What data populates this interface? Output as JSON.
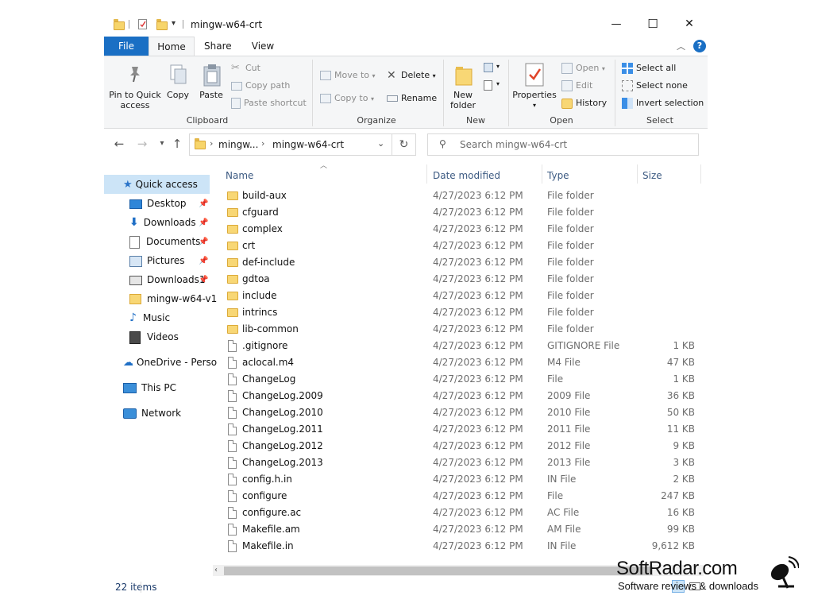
{
  "window": {
    "title": "mingw-w64-crt",
    "minimize_glyph": "—",
    "maximize_glyph": "☐",
    "close_glyph": "✕"
  },
  "tabs": [
    "File",
    "Home",
    "Share",
    "View"
  ],
  "ribbon": {
    "clipboard": {
      "label": "Clipboard",
      "pin_line1": "Pin to Quick",
      "pin_line2": "access",
      "copy": "Copy",
      "paste": "Paste",
      "cut": "Cut",
      "copy_path": "Copy path",
      "paste_shortcut": "Paste shortcut"
    },
    "organize": {
      "label": "Organize",
      "move_to": "Move to",
      "copy_to": "Copy to",
      "delete": "Delete",
      "rename": "Rename"
    },
    "new": {
      "label": "New",
      "new_folder_line1": "New",
      "new_folder_line2": "folder"
    },
    "open": {
      "label": "Open",
      "properties": "Properties",
      "open": "Open",
      "edit": "Edit",
      "history": "History"
    },
    "select": {
      "label": "Select",
      "select_all": "Select all",
      "select_none": "Select none",
      "invert_selection": "Invert selection"
    }
  },
  "address": {
    "crumb1": "mingw...",
    "crumb2": "mingw-w64-crt",
    "search_placeholder": "Search mingw-w64-crt"
  },
  "sidebar": {
    "quick_access": "Quick access",
    "items": [
      "Desktop",
      "Downloads",
      "Documents",
      "Pictures",
      "Downloads1",
      "mingw-w64-v1",
      "Music",
      "Videos"
    ],
    "onedrive": "OneDrive - Perso",
    "this_pc": "This PC",
    "network": "Network"
  },
  "columns": {
    "name": "Name",
    "date": "Date modified",
    "type": "Type",
    "size": "Size"
  },
  "files": [
    {
      "name": "build-aux",
      "date": "4/27/2023 6:12 PM",
      "type": "File folder",
      "size": "",
      "folder": true
    },
    {
      "name": "cfguard",
      "date": "4/27/2023 6:12 PM",
      "type": "File folder",
      "size": "",
      "folder": true
    },
    {
      "name": "complex",
      "date": "4/27/2023 6:12 PM",
      "type": "File folder",
      "size": "",
      "folder": true
    },
    {
      "name": "crt",
      "date": "4/27/2023 6:12 PM",
      "type": "File folder",
      "size": "",
      "folder": true
    },
    {
      "name": "def-include",
      "date": "4/27/2023 6:12 PM",
      "type": "File folder",
      "size": "",
      "folder": true
    },
    {
      "name": "gdtoa",
      "date": "4/27/2023 6:12 PM",
      "type": "File folder",
      "size": "",
      "folder": true
    },
    {
      "name": "include",
      "date": "4/27/2023 6:12 PM",
      "type": "File folder",
      "size": "",
      "folder": true
    },
    {
      "name": "intrincs",
      "date": "4/27/2023 6:12 PM",
      "type": "File folder",
      "size": "",
      "folder": true
    },
    {
      "name": "lib-common",
      "date": "4/27/2023 6:12 PM",
      "type": "File folder",
      "size": "",
      "folder": true
    },
    {
      "name": ".gitignore",
      "date": "4/27/2023 6:12 PM",
      "type": "GITIGNORE File",
      "size": "1 KB",
      "folder": false
    },
    {
      "name": "aclocal.m4",
      "date": "4/27/2023 6:12 PM",
      "type": "M4 File",
      "size": "47 KB",
      "folder": false
    },
    {
      "name": "ChangeLog",
      "date": "4/27/2023 6:12 PM",
      "type": "File",
      "size": "1 KB",
      "folder": false
    },
    {
      "name": "ChangeLog.2009",
      "date": "4/27/2023 6:12 PM",
      "type": "2009 File",
      "size": "36 KB",
      "folder": false
    },
    {
      "name": "ChangeLog.2010",
      "date": "4/27/2023 6:12 PM",
      "type": "2010 File",
      "size": "50 KB",
      "folder": false
    },
    {
      "name": "ChangeLog.2011",
      "date": "4/27/2023 6:12 PM",
      "type": "2011 File",
      "size": "11 KB",
      "folder": false
    },
    {
      "name": "ChangeLog.2012",
      "date": "4/27/2023 6:12 PM",
      "type": "2012 File",
      "size": "9 KB",
      "folder": false
    },
    {
      "name": "ChangeLog.2013",
      "date": "4/27/2023 6:12 PM",
      "type": "2013 File",
      "size": "3 KB",
      "folder": false
    },
    {
      "name": "config.h.in",
      "date": "4/27/2023 6:12 PM",
      "type": "IN File",
      "size": "2 KB",
      "folder": false
    },
    {
      "name": "configure",
      "date": "4/27/2023 6:12 PM",
      "type": "File",
      "size": "247 KB",
      "folder": false
    },
    {
      "name": "configure.ac",
      "date": "4/27/2023 6:12 PM",
      "type": "AC File",
      "size": "16 KB",
      "folder": false
    },
    {
      "name": "Makefile.am",
      "date": "4/27/2023 6:12 PM",
      "type": "AM File",
      "size": "99 KB",
      "folder": false
    },
    {
      "name": "Makefile.in",
      "date": "4/27/2023 6:12 PM",
      "type": "IN File",
      "size": "9,612 KB",
      "folder": false
    }
  ],
  "status": {
    "item_count": "22 items"
  },
  "watermark": {
    "line1": "SoftRadar.com",
    "line2": "Software reviews & downloads"
  },
  "colors": {
    "accent": "#1a6fc4",
    "selection": "#cce4f7",
    "folder": "#f8d775"
  }
}
